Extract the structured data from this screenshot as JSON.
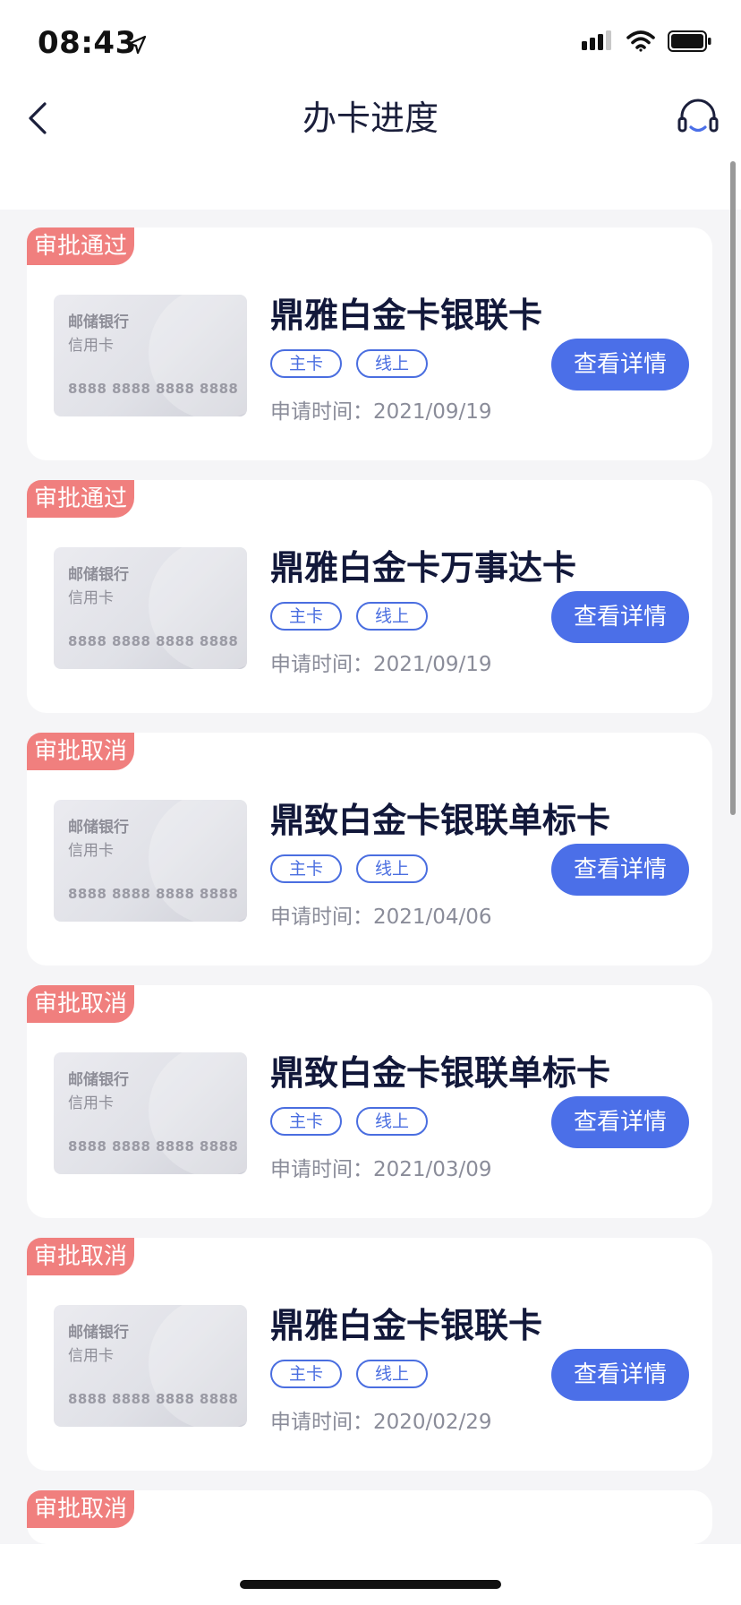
{
  "status_bar": {
    "time": "08:43"
  },
  "nav": {
    "title": "办卡进度"
  },
  "card_image": {
    "bank": "邮储银行",
    "type": "信用卡",
    "number": "8888 8888 8888 8888"
  },
  "cards": [
    {
      "status": "审批通过",
      "title": "鼎雅白金卡银联卡",
      "tags": [
        "主卡",
        "线上"
      ],
      "apply_time": "申请时间：2021/09/19",
      "button": "查看详情"
    },
    {
      "status": "审批通过",
      "title": "鼎雅白金卡万事达卡",
      "tags": [
        "主卡",
        "线上"
      ],
      "apply_time": "申请时间：2021/09/19",
      "button": "查看详情"
    },
    {
      "status": "审批取消",
      "title": "鼎致白金卡银联单标卡",
      "tags": [
        "主卡",
        "线上"
      ],
      "apply_time": "申请时间：2021/04/06",
      "button": "查看详情"
    },
    {
      "status": "审批取消",
      "title": "鼎致白金卡银联单标卡",
      "tags": [
        "主卡",
        "线上"
      ],
      "apply_time": "申请时间：2021/03/09",
      "button": "查看详情"
    },
    {
      "status": "审批取消",
      "title": "鼎雅白金卡银联卡",
      "tags": [
        "主卡",
        "线上"
      ],
      "apply_time": "申请时间：2020/02/29",
      "button": "查看详情"
    }
  ],
  "partial_card": {
    "status": "审批取消"
  },
  "colors": {
    "primary": "#4b6fe8",
    "badge": "#f07f7e",
    "background": "#f5f5f7"
  },
  "icons": {
    "back": "chevron-left-icon",
    "service": "headset-icon",
    "location": "location-arrow-icon",
    "signal": "cellular-signal-icon",
    "wifi": "wifi-icon",
    "battery": "battery-icon"
  }
}
